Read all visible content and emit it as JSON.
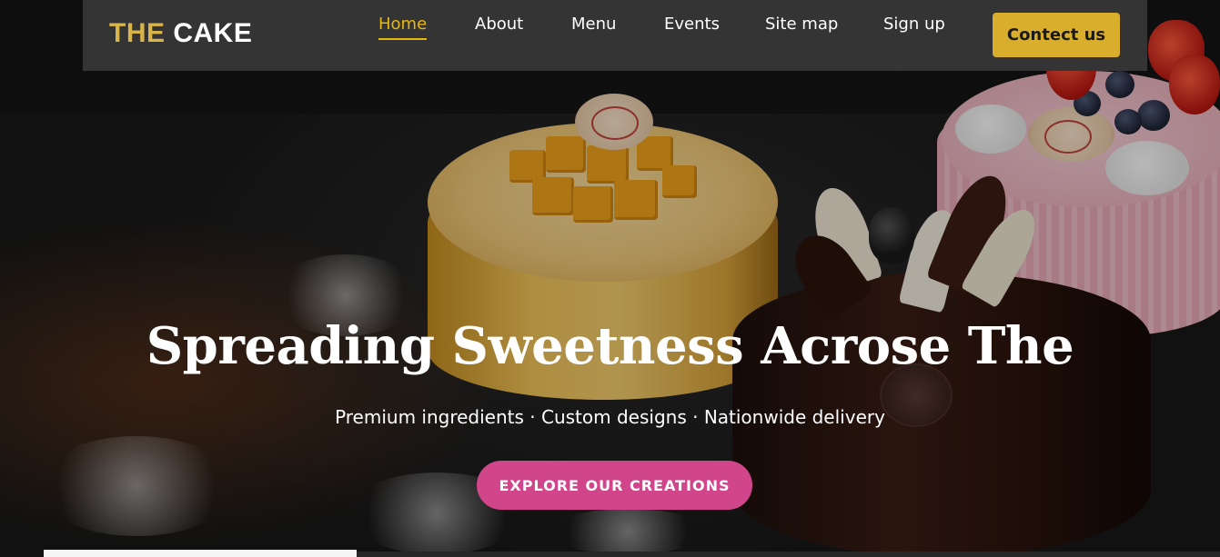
{
  "brand": {
    "part1": "THE",
    "part2": "CAKE"
  },
  "nav": {
    "items": [
      {
        "label": "Home",
        "active": true
      },
      {
        "label": "About"
      },
      {
        "label": "Menu"
      },
      {
        "label": "Events"
      },
      {
        "label": "Site map"
      },
      {
        "label": "Sign up"
      }
    ],
    "contact_label": "Contect us"
  },
  "hero": {
    "title": "Spreading Sweetness Acrose The",
    "subtitle": "Premium ingredients · Custom designs · Nationwide delivery",
    "cta_label": "EXPLORE OUR CREATIONS"
  },
  "colors": {
    "accent_gold": "#e6b80f",
    "contact_button": "#d9ae2c",
    "cta_pink": "#d1458a",
    "navbar_bg": "#343434"
  }
}
